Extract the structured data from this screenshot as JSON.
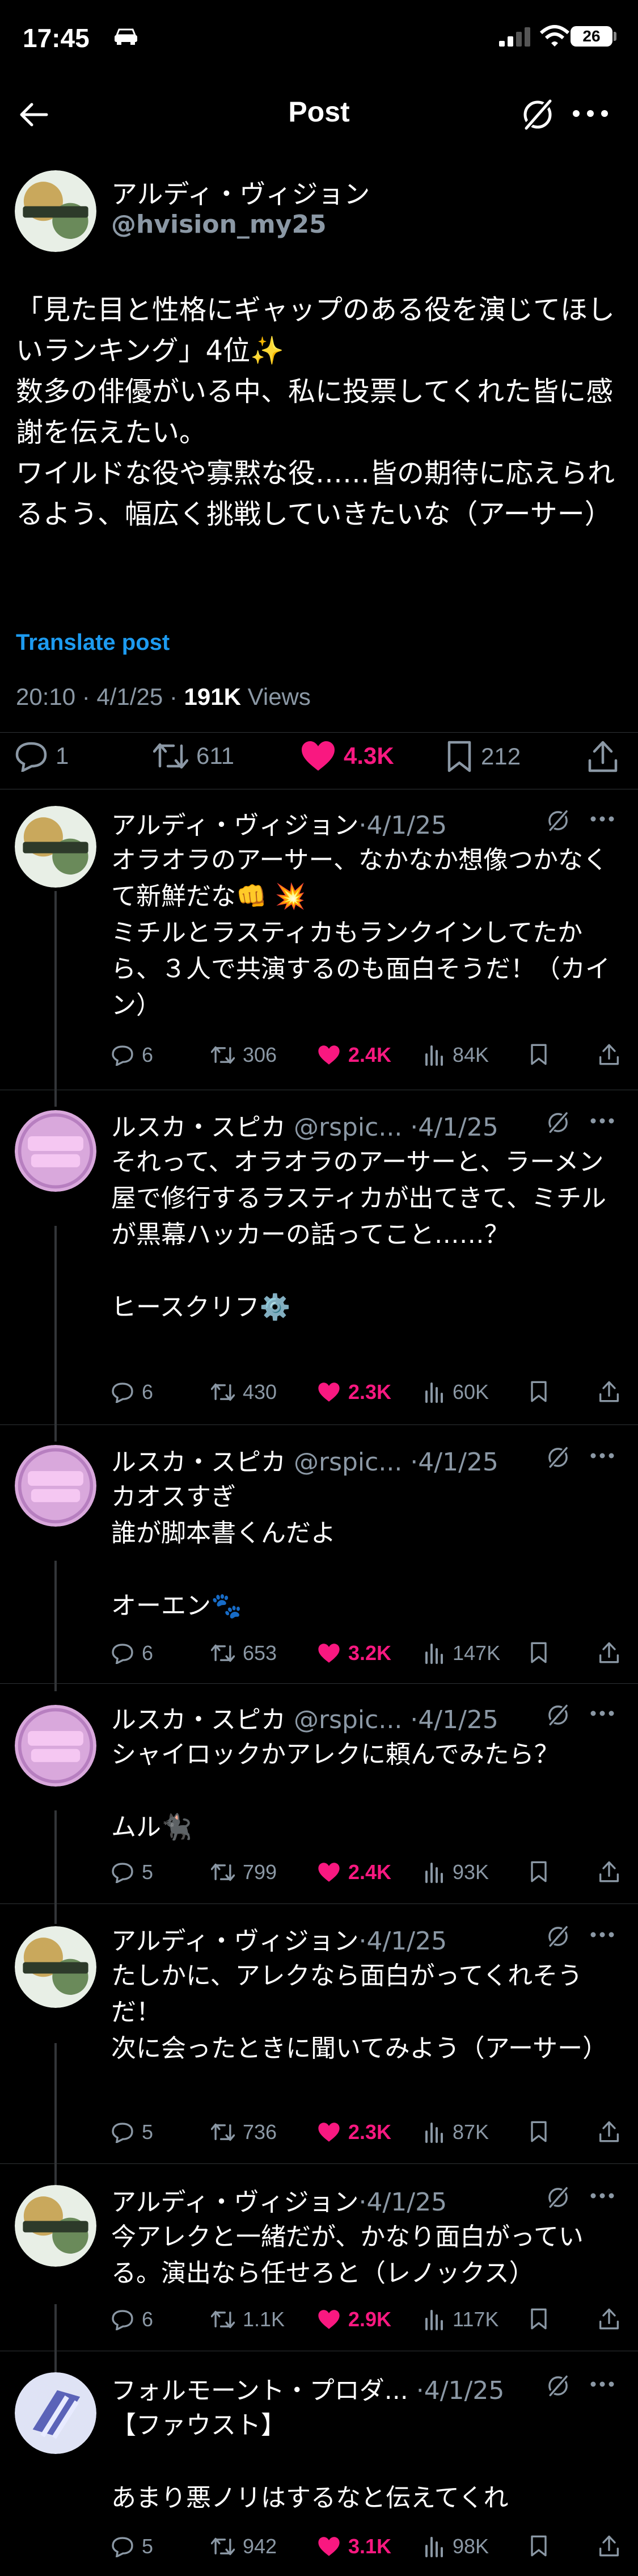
{
  "status_bar": {
    "time": "17:45",
    "battery": "26"
  },
  "nav": {
    "title": "Post"
  },
  "main_post": {
    "author_name": "アルディ・ヴィジョン",
    "author_handle": "@hvision_my25",
    "text": "「見た目と性格にギャップのある役を演じてほしいランキング」4位✨\n数多の俳優がいる中、私に投票してくれた皆に感謝を伝えたい。\nワイルドな役や寡黙な役……皆の期待に応えられるよう、幅広く挑戦していきたいな（アーサー）",
    "translate_label": "Translate post",
    "time_date": "20:10 · 4/1/25 · ",
    "views_count": "191K",
    "views_label": " Views",
    "stats": {
      "replies": "1",
      "reposts": "611",
      "likes": "4.3K",
      "bookmarks": "212"
    }
  },
  "replies": [
    {
      "name": "アルディ・ヴィジョン",
      "handle": "",
      "date": "·4/1/25",
      "text": "オラオラのアーサー、なかなか想像つかなくて新鮮だな👊 💥\nミチルとラスティカもランクインしてたから、３人で共演するのも面白そうだ！（カイン）",
      "replies": "6",
      "reposts": "306",
      "likes": "2.4K",
      "views": "84K"
    },
    {
      "name": "ルスカ・スピカ",
      "handle": " @rspic...",
      "date": " ·4/1/25",
      "text": "それって、オラオラのアーサーと、ラーメン屋で修行するラスティカが出てきて、ミチルが黒幕ハッカーの話ってこと……？\n\nヒースクリフ⚙️",
      "replies": "6",
      "reposts": "430",
      "likes": "2.3K",
      "views": "60K"
    },
    {
      "name": "ルスカ・スピカ",
      "handle": " @rspic...",
      "date": " ·4/1/25",
      "text": "カオスすぎ\n誰が脚本書くんだよ\n\nオーエン🐾",
      "replies": "6",
      "reposts": "653",
      "likes": "3.2K",
      "views": "147K"
    },
    {
      "name": "ルスカ・スピカ",
      "handle": " @rspic...",
      "date": " ·4/1/25",
      "text": "シャイロックかアレクに頼んでみたら？\n\nムル🐈‍⬛",
      "replies": "5",
      "reposts": "799",
      "likes": "2.4K",
      "views": "93K"
    },
    {
      "name": "アルディ・ヴィジョン",
      "handle": "",
      "date": "·4/1/25",
      "text": "たしかに、アレクなら面白がってくれそうだ！\n次に会ったときに聞いてみよう（アーサー）",
      "replies": "5",
      "reposts": "736",
      "likes": "2.3K",
      "views": "87K"
    },
    {
      "name": "アルディ・ヴィジョン",
      "handle": "",
      "date": "·4/1/25",
      "text": "今アレクと一緒だが、かなり面白がっている。演出なら任せろと（レノックス）",
      "replies": "6",
      "reposts": "1.1K",
      "likes": "2.9K",
      "views": "117K"
    },
    {
      "name": "フォルモーント・プロダ...",
      "handle": "",
      "date": " ·4/1/25",
      "text": "【ファウスト】\n\nあまり悪ノリはするなと伝えてくれ",
      "replies": "5",
      "reposts": "942",
      "likes": "3.1K",
      "views": "98K"
    }
  ],
  "colors": {
    "accent": "#1d9bf0",
    "like": "#f91880",
    "muted": "#8b98a5"
  }
}
